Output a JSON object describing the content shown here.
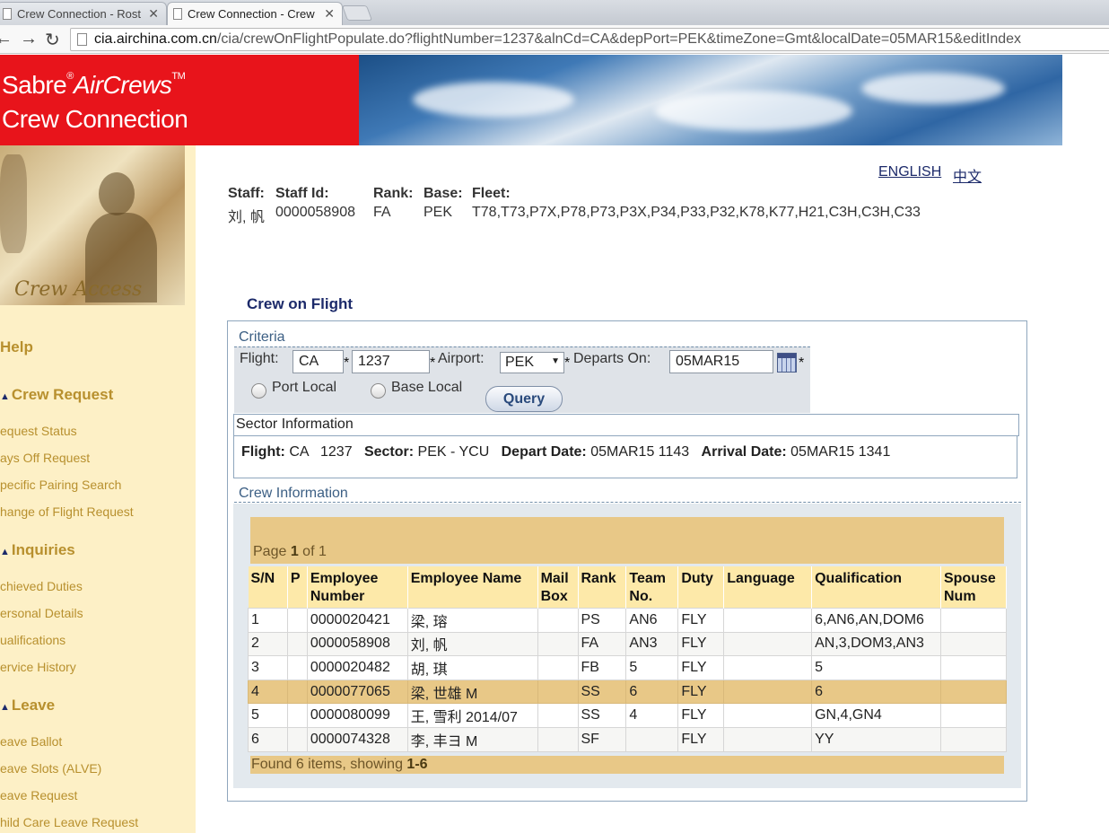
{
  "browser": {
    "tabs": [
      {
        "label": "Crew Connection - Rost",
        "active": false
      },
      {
        "label": "Crew Connection - Crew",
        "active": true
      }
    ],
    "url_host": "cia.airchina.com.cn",
    "url_path": "/cia/crewOnFlightPopulate.do?flightNumber=1237&alnCd=CA&depPort=PEK&timeZone=Gmt&localDate=05MAR15&editIndex"
  },
  "banner": {
    "brand_sabre": "Sabre",
    "brand_aircrews": "AirCrews",
    "brand_tm": "TM",
    "brand_line2": "Crew Connection"
  },
  "sidebar": {
    "logo_text": "Crew Access",
    "help": "Help",
    "sections": [
      {
        "title": "Crew Request",
        "items": [
          "equest Status",
          "ays Off Request",
          "pecific Pairing Search",
          "hange of Flight Request"
        ]
      },
      {
        "title": "Inquiries",
        "items": [
          "chieved Duties",
          "ersonal Details",
          "ualifications",
          "ervice History"
        ]
      },
      {
        "title": "Leave",
        "items": [
          "eave Ballot",
          "eave Slots (ALVE)",
          "eave Request",
          "hild Care Leave Request"
        ]
      }
    ]
  },
  "lang": {
    "english": "ENGLISH",
    "chinese": "中文"
  },
  "staff": {
    "headers": {
      "staff": "Staff:",
      "staff_id": "Staff Id:",
      "rank": "Rank:",
      "base": "Base:",
      "fleet": "Fleet:"
    },
    "values": {
      "staff": "刘, 帆",
      "staff_id": "0000058908",
      "rank": "FA",
      "base": "PEK",
      "fleet": "T78,T73,P7X,P78,P73,P3X,P34,P33,P32,K78,K77,H21,C3H,C3H,C33"
    }
  },
  "page_title": "Crew on Flight",
  "criteria": {
    "legend": "Criteria",
    "flight_label": "Flight:",
    "airline_value": "CA",
    "flight_number_value": "1237",
    "airport_label": "Airport:",
    "airport_value": "PEK",
    "departs_label": "Departs On:",
    "departs_value": "05MAR15",
    "required_mark": "*",
    "port_local": "Port Local",
    "base_local": "Base Local",
    "query": "Query"
  },
  "sector": {
    "title": "Sector Information",
    "flight_label": "Flight:",
    "flight_value": "CA   1237",
    "sector_label": "Sector:",
    "sector_value": "PEK - YCU",
    "depart_label": "Depart Date:",
    "depart_value": "05MAR15 1143",
    "arrival_label": "Arrival Date:",
    "arrival_value": "05MAR15 1341"
  },
  "crew": {
    "legend": "Crew Information",
    "pager_prefix": "Page ",
    "pager_current": "1",
    "pager_suffix": " of 1",
    "columns": [
      "S/N",
      "P",
      "Employee Number",
      "Employee Name",
      "Mail Box",
      "Rank",
      "Team No.",
      "Duty",
      "Language",
      "Qualification",
      "Spouse Num"
    ],
    "rows": [
      [
        "1",
        "",
        "0000020421",
        "梁, 瑢",
        "",
        "PS",
        "AN6",
        "FLY",
        "",
        "6,AN6,AN,DOM6",
        ""
      ],
      [
        "2",
        "",
        "0000058908",
        "刘, 帆",
        "",
        "FA",
        "AN3",
        "FLY",
        "",
        "AN,3,DOM3,AN3",
        ""
      ],
      [
        "3",
        "",
        "0000020482",
        "胡, 琪",
        "",
        "FB",
        "5",
        "FLY",
        "",
        "5",
        ""
      ],
      [
        "4",
        "",
        "0000077065",
        "梁, 世雄 M",
        "",
        "SS",
        "6",
        "FLY",
        "",
        "6",
        ""
      ],
      [
        "5",
        "",
        "0000080099",
        "王, 雪利 2014/07",
        "",
        "SS",
        "4",
        "FLY",
        "",
        "GN,4,GN4",
        ""
      ],
      [
        "6",
        "",
        "0000074328",
        "李, 丰ヨ M",
        "",
        "SF",
        "",
        "FLY",
        "",
        "YY",
        ""
      ]
    ],
    "found_prefix": "Found 6 items, showing ",
    "found_range": "1-6"
  }
}
